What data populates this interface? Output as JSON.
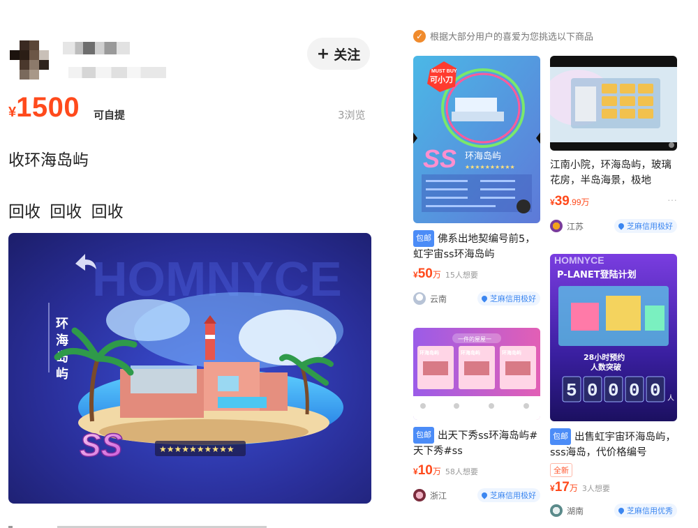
{
  "listing": {
    "follow_label": "关注",
    "price_currency": "¥",
    "price_value": "1500",
    "pickup_label": "可自提",
    "views": "3浏览",
    "title": "收环海岛屿",
    "description": "回收 回收  回收",
    "hero": {
      "side_title": "环海岛屿",
      "rank_text": "SS",
      "stars": "★★★★★★★★★★",
      "watermark": "HOMNYCE"
    }
  },
  "recommend": {
    "heading": "根据大部分用户的喜爱为您挑选以下商品",
    "cards": [
      {
        "img_banner": "MUST BUY",
        "img_logo": "可小刀",
        "img_rank": "SS",
        "img_name": "环海岛屿",
        "badge": "包邮",
        "title": "佛系出地契编号前5，虹宇宙ss环海岛屿",
        "price_currency": "¥",
        "price_value": "50",
        "price_unit": "万",
        "want": "15人想要",
        "location": "云南",
        "credit": "芝麻信用极好"
      },
      {
        "badge": "",
        "title": "江南小院，环海岛屿，玻璃花房，半岛海景，极地",
        "price_currency": "¥",
        "price_value": "39",
        "price_decimal": ".99",
        "price_unit": "万",
        "want": "",
        "location": "江苏",
        "credit": "芝麻信用极好"
      },
      {
        "img_banner": "一件的屋屋一",
        "img_tiles": [
          "环海岛屿",
          "环海岛屿",
          "环海岛屿"
        ],
        "badge": "包邮",
        "title": "出天下秀ss环海岛屿#天下秀#ss",
        "price_currency": "¥",
        "price_value": "10",
        "price_unit": "万",
        "want": "58人想要",
        "location": "浙江",
        "credit": "芝麻信用极好"
      },
      {
        "img_top": "HOMNYCE",
        "img_headline": "P-LANET登陆计划",
        "img_sub1": "28小时预约",
        "img_sub2": "人数突破",
        "img_counter": [
          "5",
          "0",
          "0",
          "0",
          "0"
        ],
        "img_counter_unit": "人",
        "badge": "包邮",
        "title": "出售虹宇宙环海岛屿，sss海岛，代价格编号",
        "tag": "全新",
        "price_currency": "¥",
        "price_value": "17",
        "price_unit": "万",
        "want": "3人想要",
        "location": "湖南",
        "credit": "芝麻信用优秀"
      }
    ]
  },
  "colors": {
    "accent_price": "#ff4a1c",
    "credit_blue": "#3b86f0",
    "badge_blue": "#4b8cf7",
    "check_orange": "#f08b2d"
  }
}
